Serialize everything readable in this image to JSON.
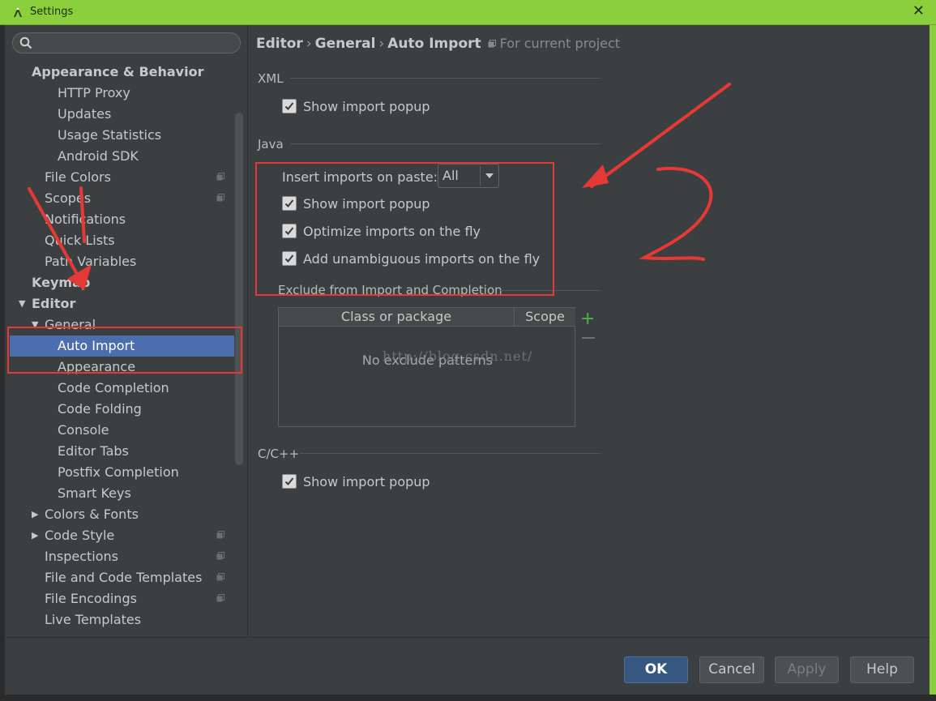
{
  "window": {
    "title": "Settings"
  },
  "search": {
    "placeholder": ""
  },
  "sidebar": {
    "items": [
      {
        "label": "Appearance & Behavior",
        "level": 0,
        "bold": true,
        "expanded": null
      },
      {
        "label": "HTTP Proxy",
        "level": 2
      },
      {
        "label": "Updates",
        "level": 2
      },
      {
        "label": "Usage Statistics",
        "level": 2
      },
      {
        "label": "Android SDK",
        "level": 2
      },
      {
        "label": "File Colors",
        "level": 1,
        "project_icon": true
      },
      {
        "label": "Scopes",
        "level": 1,
        "project_icon": true
      },
      {
        "label": "Notifications",
        "level": 1
      },
      {
        "label": "Quick Lists",
        "level": 1
      },
      {
        "label": "Path Variables",
        "level": 1
      },
      {
        "label": "Keymap",
        "level": 0,
        "bold": true
      },
      {
        "label": "Editor",
        "level": 0,
        "bold": true,
        "expanded": true
      },
      {
        "label": "General",
        "level": 1,
        "expanded": true
      },
      {
        "label": "Auto Import",
        "level": 2,
        "selected": true
      },
      {
        "label": "Appearance",
        "level": 2
      },
      {
        "label": "Code Completion",
        "level": 2
      },
      {
        "label": "Code Folding",
        "level": 2
      },
      {
        "label": "Console",
        "level": 2
      },
      {
        "label": "Editor Tabs",
        "level": 2
      },
      {
        "label": "Postfix Completion",
        "level": 2
      },
      {
        "label": "Smart Keys",
        "level": 2
      },
      {
        "label": "Colors & Fonts",
        "level": 1,
        "expanded": false
      },
      {
        "label": "Code Style",
        "level": 1,
        "expanded": false,
        "project_icon": true
      },
      {
        "label": "Inspections",
        "level": 1,
        "project_icon": true
      },
      {
        "label": "File and Code Templates",
        "level": 1,
        "project_icon": true
      },
      {
        "label": "File Encodings",
        "level": 1,
        "project_icon": true
      },
      {
        "label": "Live Templates",
        "level": 1
      }
    ]
  },
  "breadcrumb": {
    "parts": [
      "Editor",
      "General",
      "Auto Import"
    ],
    "separator": "›",
    "note": "For current project"
  },
  "xml": {
    "title": "XML",
    "show_import_popup": {
      "label": "Show import popup",
      "checked": true
    }
  },
  "java": {
    "title": "Java",
    "insert_imports_label": "Insert imports on paste:",
    "insert_imports_value": "All",
    "show_import_popup": {
      "label": "Show import popup",
      "checked": true
    },
    "optimize_imports": {
      "label": "Optimize imports on the fly",
      "checked": true
    },
    "add_unambiguous": {
      "label": "Add unambiguous imports on the fly",
      "checked": true
    },
    "exclude_title": "Exclude from Import and Completion",
    "table": {
      "columns": [
        "Class or package",
        "Scope"
      ],
      "empty_text": "No exclude patterns"
    }
  },
  "cpp": {
    "title": "C/C++",
    "show_import_popup": {
      "label": "Show import popup",
      "checked": true
    }
  },
  "buttons": {
    "ok": "OK",
    "cancel": "Cancel",
    "apply": "Apply",
    "help": "Help"
  },
  "annotation": {
    "number": "2",
    "watermark": "http://blog.csdn.net/"
  },
  "colors": {
    "title_bar": "#8ccf3c",
    "selection": "#4b6eaf",
    "annotation": "#e53935",
    "background": "#3c3f41"
  }
}
